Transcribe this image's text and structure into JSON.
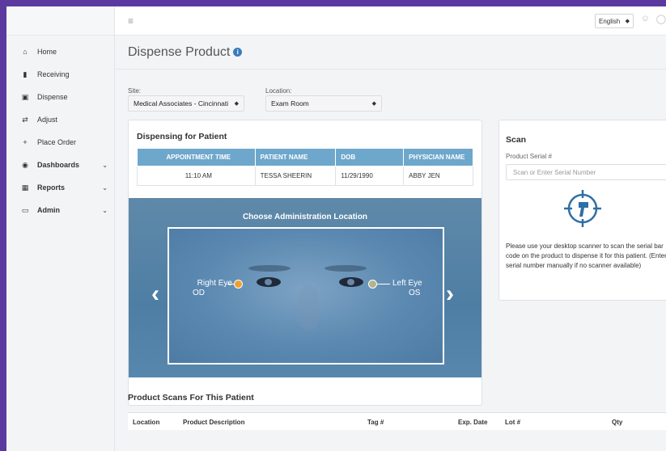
{
  "header": {
    "menu_icon": "hamburger-icon",
    "language": "English",
    "user_icon": "user-icon",
    "power_icon": "power-icon"
  },
  "sidebar": {
    "items": [
      {
        "label": "Home",
        "icon": "home-icon"
      },
      {
        "label": "Receiving",
        "icon": "truck-icon"
      },
      {
        "label": "Dispense",
        "icon": "dispense-icon"
      },
      {
        "label": "Adjust",
        "icon": "adjust-icon"
      },
      {
        "label": "Place Order",
        "icon": "plus-icon"
      },
      {
        "label": "Dashboards",
        "icon": "dashboard-icon"
      },
      {
        "label": "Reports",
        "icon": "report-icon"
      },
      {
        "label": "Admin",
        "icon": "monitor-icon"
      }
    ]
  },
  "page": {
    "title": "Dispense Product",
    "site_label": "Site:",
    "site_value": "Medical Associates - Cincinnati",
    "location_label": "Location:",
    "location_value": "Exam Room"
  },
  "patient": {
    "title": "Dispensing for Patient",
    "columns": [
      "APPOINTMENT TIME",
      "PATIENT NAME",
      "DOB",
      "PHYSICIAN NAME"
    ],
    "row": [
      "11:10 AM",
      "TESSA SHEERIN",
      "11/29/1990",
      "ABBY JEN"
    ]
  },
  "admin": {
    "title": "Choose Administration Location",
    "right_eye_line1": "Right Eye",
    "right_eye_line2": "OD",
    "left_eye_line1": "Left Eye",
    "left_eye_line2": "OS",
    "right_dot_color": "#f0a030",
    "left_dot_color": "#b5b38a"
  },
  "scan": {
    "title": "Scan",
    "serial_label": "Product Serial #",
    "serial_placeholder": "Scan or Enter Serial Number",
    "instructions": "Please use your desktop scanner to scan the serial bar code on the product to dispense it for this patient. (Enter serial number manually if no scanner available)"
  },
  "scans_table": {
    "title": "Product Scans For This Patient",
    "columns": [
      "Location",
      "Product Description",
      "Tag #",
      "Exp. Date",
      "Lot #",
      "Qty"
    ]
  }
}
